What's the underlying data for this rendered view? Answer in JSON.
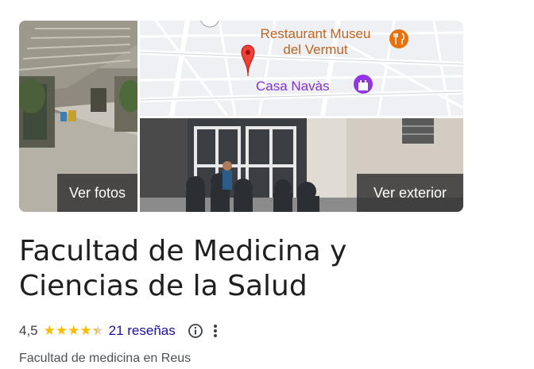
{
  "media": {
    "photos_button": "Ver fotos",
    "exterior_button": "Ver exterior",
    "map": {
      "poi_restaurant": [
        "Restaurant Museu",
        "del Vermut"
      ],
      "poi_landmark": "Casa Navàs"
    }
  },
  "place": {
    "title": "Facultad de Medicina y Ciencias de la Salud",
    "rating": "4,5",
    "rating_value": 4.5,
    "reviews": "21 reseñas",
    "category": "Facultad de medicina en Reus"
  },
  "colors": {
    "star": "#fbbc04",
    "link": "#1a0dab",
    "restaurant_poi": "#e8710a",
    "landmark_poi": "#9334e6",
    "pin": "#ea4335"
  }
}
